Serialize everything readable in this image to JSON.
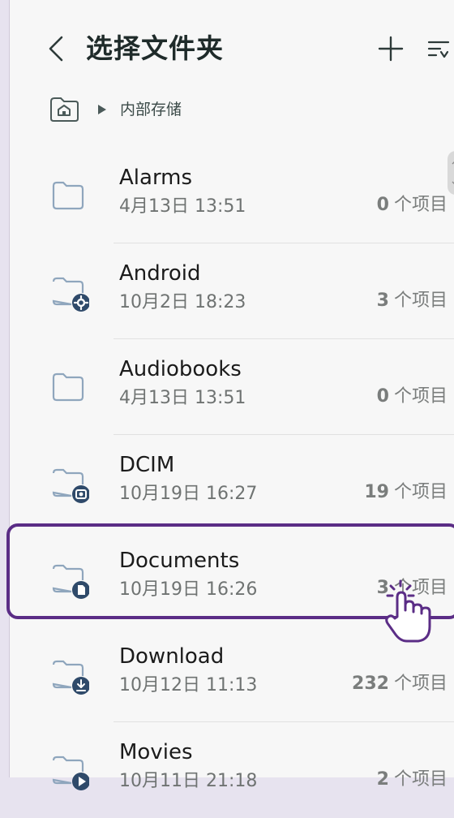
{
  "header": {
    "title": "选择文件夹"
  },
  "breadcrumb": {
    "path": "内部存储"
  },
  "folders": [
    {
      "name": "Alarms",
      "date": "4月13日 13:51",
      "count": "0",
      "count_suffix": "个项目",
      "icon": "folder-icon"
    },
    {
      "name": "Android",
      "date": "10月2日 18:23",
      "count": "3",
      "count_suffix": "个项目",
      "icon": "folder-settings-icon"
    },
    {
      "name": "Audiobooks",
      "date": "4月13日 13:51",
      "count": "0",
      "count_suffix": "个项目",
      "icon": "folder-icon"
    },
    {
      "name": "DCIM",
      "date": "10月19日 16:27",
      "count": "19",
      "count_suffix": "个项目",
      "icon": "folder-camera-icon"
    },
    {
      "name": "Documents",
      "date": "10月19日 16:26",
      "count": "3",
      "count_suffix": "个项目",
      "icon": "folder-document-icon"
    },
    {
      "name": "Download",
      "date": "10月12日 11:13",
      "count": "232",
      "count_suffix": "个项目",
      "icon": "folder-download-icon"
    },
    {
      "name": "Movies",
      "date": "10月11日 21:18",
      "count": "2",
      "count_suffix": "个项目",
      "icon": "folder-play-icon"
    }
  ],
  "colors": {
    "accent_highlight": "#5b2d86",
    "icon_stroke": "#8fa6bd",
    "badge_fill": "#2f4a6a"
  }
}
